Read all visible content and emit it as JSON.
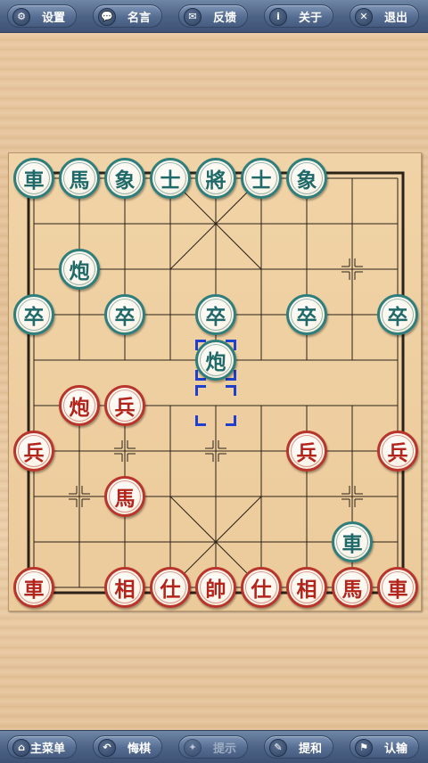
{
  "top_bar": {
    "buttons": [
      {
        "label": "设置",
        "icon": "gear-icon",
        "glyph": "⚙"
      },
      {
        "label": "名言",
        "icon": "speech-bubble-icon",
        "glyph": "💬"
      },
      {
        "label": "反馈",
        "icon": "mail-icon",
        "glyph": "✉"
      },
      {
        "label": "关于",
        "icon": "info-icon",
        "glyph": "i"
      },
      {
        "label": "退出",
        "icon": "close-icon",
        "glyph": "✕"
      }
    ]
  },
  "bottom_bar": {
    "buttons": [
      {
        "label": "主菜单",
        "icon": "home-icon",
        "glyph": "⌂",
        "disabled": false
      },
      {
        "label": "悔棋",
        "icon": "undo-icon",
        "glyph": "↶",
        "disabled": false
      },
      {
        "label": "提示",
        "icon": "lightbulb-icon",
        "glyph": "✦",
        "disabled": true
      },
      {
        "label": "提和",
        "icon": "pen-icon",
        "glyph": "✎",
        "disabled": false
      },
      {
        "label": "认输",
        "icon": "flag-icon",
        "glyph": "⚑",
        "disabled": false
      }
    ]
  },
  "board": {
    "files": 9,
    "ranks": 10,
    "pieces": [
      {
        "char": "車",
        "side": "black",
        "col": 0,
        "row": 0
      },
      {
        "char": "馬",
        "side": "black",
        "col": 1,
        "row": 0
      },
      {
        "char": "象",
        "side": "black",
        "col": 2,
        "row": 0
      },
      {
        "char": "士",
        "side": "black",
        "col": 3,
        "row": 0
      },
      {
        "char": "將",
        "side": "black",
        "col": 4,
        "row": 0
      },
      {
        "char": "士",
        "side": "black",
        "col": 5,
        "row": 0
      },
      {
        "char": "象",
        "side": "black",
        "col": 6,
        "row": 0
      },
      {
        "char": "炮",
        "side": "black",
        "col": 1,
        "row": 2
      },
      {
        "char": "卒",
        "side": "black",
        "col": 0,
        "row": 3
      },
      {
        "char": "卒",
        "side": "black",
        "col": 2,
        "row": 3
      },
      {
        "char": "卒",
        "side": "black",
        "col": 4,
        "row": 3
      },
      {
        "char": "卒",
        "side": "black",
        "col": 6,
        "row": 3
      },
      {
        "char": "卒",
        "side": "black",
        "col": 8,
        "row": 3
      },
      {
        "char": "炮",
        "side": "black",
        "col": 4,
        "row": 4
      },
      {
        "char": "炮",
        "side": "red",
        "col": 1,
        "row": 5
      },
      {
        "char": "兵",
        "side": "red",
        "col": 2,
        "row": 5
      },
      {
        "char": "兵",
        "side": "red",
        "col": 0,
        "row": 6
      },
      {
        "char": "兵",
        "side": "red",
        "col": 6,
        "row": 6
      },
      {
        "char": "兵",
        "side": "red",
        "col": 8,
        "row": 6
      },
      {
        "char": "馬",
        "side": "red",
        "col": 2,
        "row": 7
      },
      {
        "char": "車",
        "side": "black",
        "col": 7,
        "row": 8
      },
      {
        "char": "車",
        "side": "red",
        "col": 0,
        "row": 9
      },
      {
        "char": "相",
        "side": "red",
        "col": 2,
        "row": 9
      },
      {
        "char": "仕",
        "side": "red",
        "col": 3,
        "row": 9
      },
      {
        "char": "帥",
        "side": "red",
        "col": 4,
        "row": 9
      },
      {
        "char": "仕",
        "side": "red",
        "col": 5,
        "row": 9
      },
      {
        "char": "相",
        "side": "red",
        "col": 6,
        "row": 9
      },
      {
        "char": "馬",
        "side": "red",
        "col": 7,
        "row": 9
      },
      {
        "char": "車",
        "side": "red",
        "col": 8,
        "row": 9
      }
    ],
    "selection_markers": [
      {
        "col": 4,
        "row": 4
      },
      {
        "col": 4,
        "row": 5
      }
    ],
    "point_markers": [
      {
        "col": 7,
        "row": 2
      },
      {
        "col": 2,
        "row": 6
      },
      {
        "col": 4,
        "row": 6
      },
      {
        "col": 1,
        "row": 7
      },
      {
        "col": 7,
        "row": 7
      }
    ]
  },
  "colors": {
    "black_piece": "#2f7e7c",
    "red_piece": "#b8352b",
    "selection": "#1f3fd0",
    "board_line": "#2a2118"
  }
}
